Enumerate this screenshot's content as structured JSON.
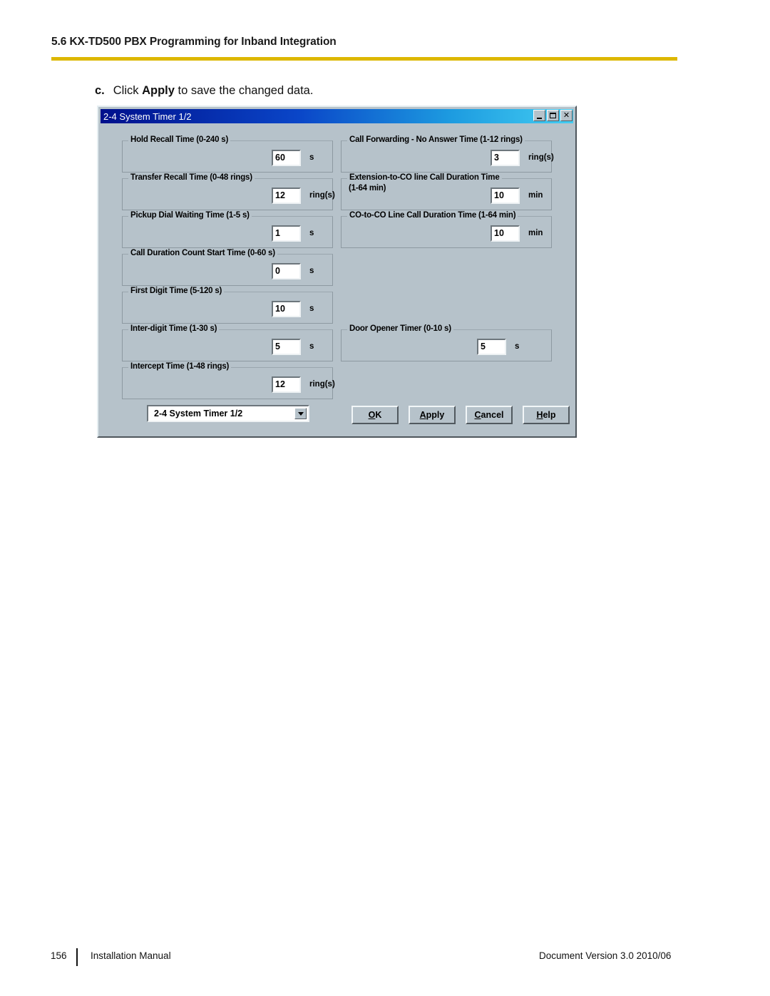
{
  "header": {
    "section_title": "5.6 KX-TD500 PBX Programming for Inband Integration",
    "rule_color": "#ddb700"
  },
  "instruction": {
    "step": "c.",
    "text_before": "Click ",
    "emphasis": "Apply",
    "text_after": " to save the changed data."
  },
  "dialog": {
    "title": "2-4 System Timer 1/2",
    "title_colors": {
      "start": "#00108c",
      "end": "#43cdf2"
    },
    "background": "#b6c2ca",
    "window_buttons": [
      {
        "name": "minimize",
        "glyph": "_"
      },
      {
        "name": "maximize",
        "glyph": "□"
      },
      {
        "name": "close",
        "glyph": "×"
      }
    ],
    "left_fields": [
      {
        "label": "Hold Recall Time (0-240 s)",
        "value": "60",
        "unit": "s"
      },
      {
        "label": "Transfer Recall Time (0-48 rings)",
        "value": "12",
        "unit": "ring(s)"
      },
      {
        "label": "Pickup Dial Waiting Time (1-5 s)",
        "value": "1",
        "unit": "s"
      },
      {
        "label": "Call Duration Count Start Time (0-60 s)",
        "value": "0",
        "unit": "s"
      },
      {
        "label": "First Digit Time (5-120 s)",
        "value": "10",
        "unit": "s"
      },
      {
        "label": "Inter-digit Time (1-30 s)",
        "value": "5",
        "unit": "s"
      },
      {
        "label": "Intercept Time (1-48 rings)",
        "value": "12",
        "unit": "ring(s)"
      }
    ],
    "right_fields": [
      {
        "label": "Call Forwarding - No Answer Time (1-12 rings)",
        "label2": "",
        "value": "3",
        "unit": "ring(s)"
      },
      {
        "label": "Extension-to-CO line Call Duration Time",
        "label2": "(1-64 min)",
        "value": "10",
        "unit": "min"
      },
      {
        "label": "CO-to-CO Line Call Duration Time (1-64 min)",
        "label2": "",
        "value": "10",
        "unit": "min"
      },
      {
        "label": "Door Opener Timer (0-10 s)",
        "label2": "",
        "value": "5",
        "unit": "s"
      }
    ],
    "combo": {
      "selected": "2-4 System Timer 1/2"
    },
    "buttons": [
      {
        "mnemonic": "O",
        "rest": "K"
      },
      {
        "mnemonic": "A",
        "rest": "pply"
      },
      {
        "mnemonic": "C",
        "rest": "ancel"
      },
      {
        "mnemonic": "H",
        "rest": "elp"
      }
    ]
  },
  "footer": {
    "page_number": "156",
    "manual_name": "Installation Manual",
    "document_version": "Document Version  3.0  2010/06"
  }
}
